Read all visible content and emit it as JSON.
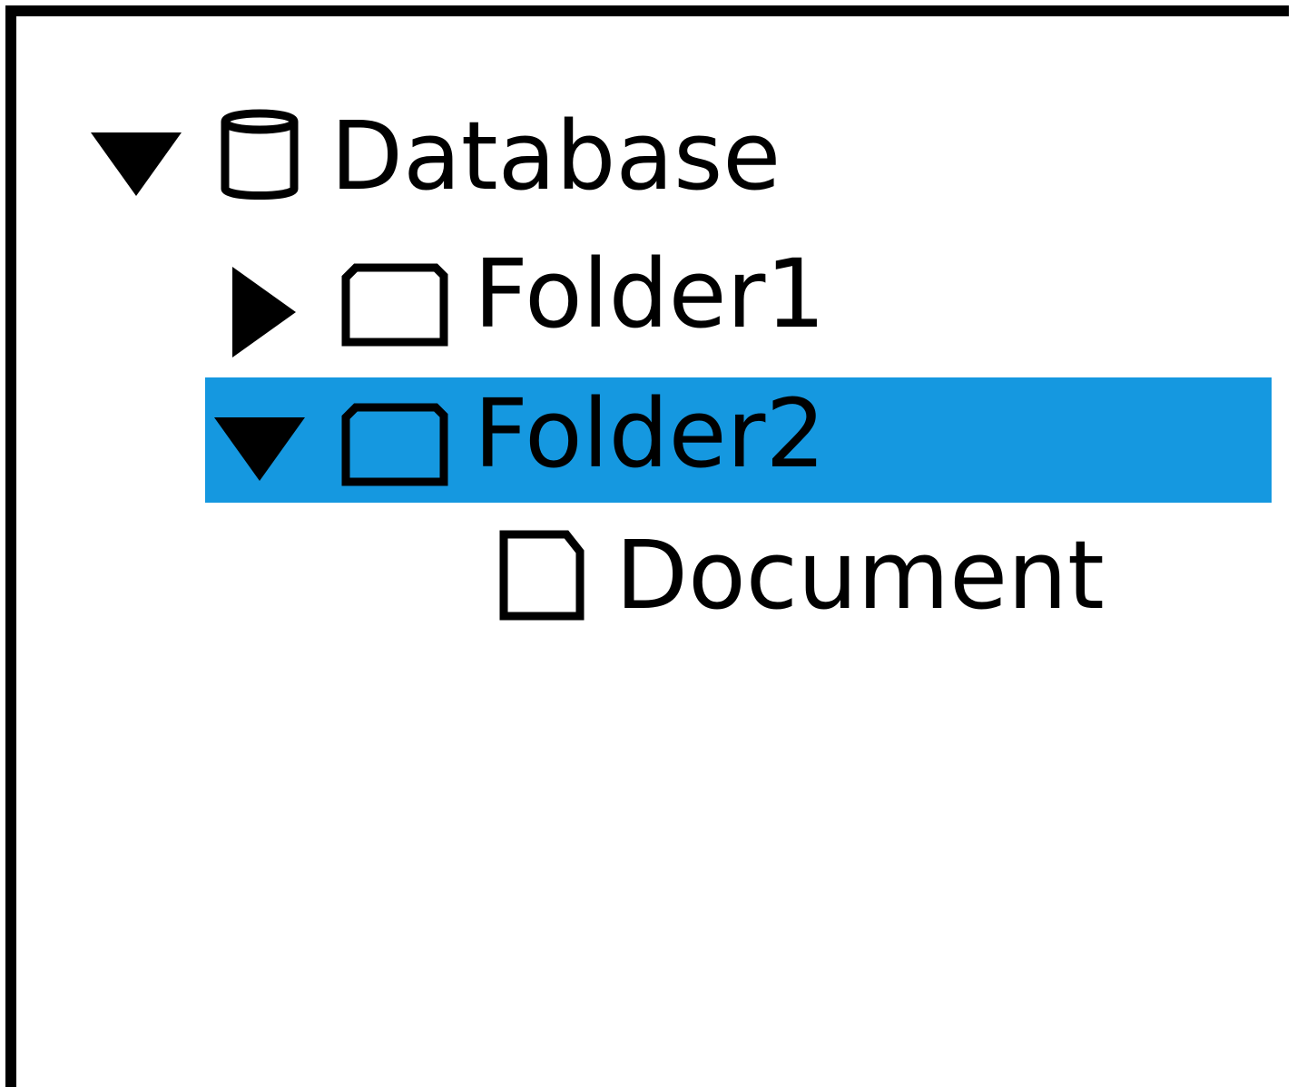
{
  "tree": {
    "nodes": [
      {
        "label": "Database",
        "icon": "database-icon",
        "toggle": "expanded-arrow-icon",
        "depth": 0,
        "expanded": true,
        "selected": false
      },
      {
        "label": "Folder1",
        "icon": "folder-icon",
        "toggle": "collapsed-arrow-icon",
        "depth": 1,
        "expanded": false,
        "selected": false
      },
      {
        "label": "Folder2",
        "icon": "folder-icon",
        "toggle": "expanded-arrow-icon",
        "depth": 1,
        "expanded": true,
        "selected": true
      },
      {
        "label": "Document",
        "icon": "document-icon",
        "toggle": null,
        "depth": 2,
        "selected": false
      }
    ]
  },
  "colors": {
    "selection": "#1598e0",
    "ink": "#000000",
    "background": "#ffffff"
  }
}
